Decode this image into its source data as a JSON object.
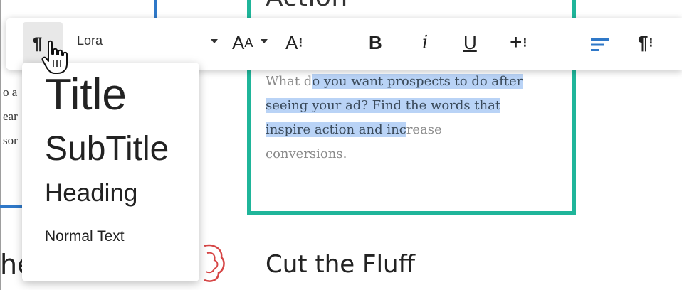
{
  "document": {
    "heading_top": "Action",
    "body_lines_highlighted": [
      "o you want prospects to do after",
      "seeing your ad? Find the words that",
      "inspire action and inc"
    ],
    "body_prefix": "What d",
    "body_suffix_line3": "rease",
    "body_line4": "conversions.",
    "section_title": "Cut the Fluff",
    "left_partial_lines": [
      "o a",
      "ear",
      "sor"
    ],
    "left_partial_heading": "he"
  },
  "toolbar": {
    "paragraph_icon": "¶",
    "font_name": "Lora",
    "font_size_label": "A",
    "font_size_label_small": "A",
    "spacing_label": "A",
    "bold_label": "B",
    "italic_label": "i",
    "underline_label": "U",
    "more_label": "+",
    "paragraph2_icon": "¶",
    "icons": [
      "paragraph-icon",
      "chevron-down-icon",
      "align-left-icon",
      "plus-icon"
    ]
  },
  "dropdown": {
    "items": [
      "Title",
      "SubTitle",
      "Heading",
      "Normal Text"
    ]
  },
  "colors": {
    "accent_green": "#1fb59a",
    "accent_blue": "#2f78c8",
    "highlight": "#b9d3f6"
  }
}
